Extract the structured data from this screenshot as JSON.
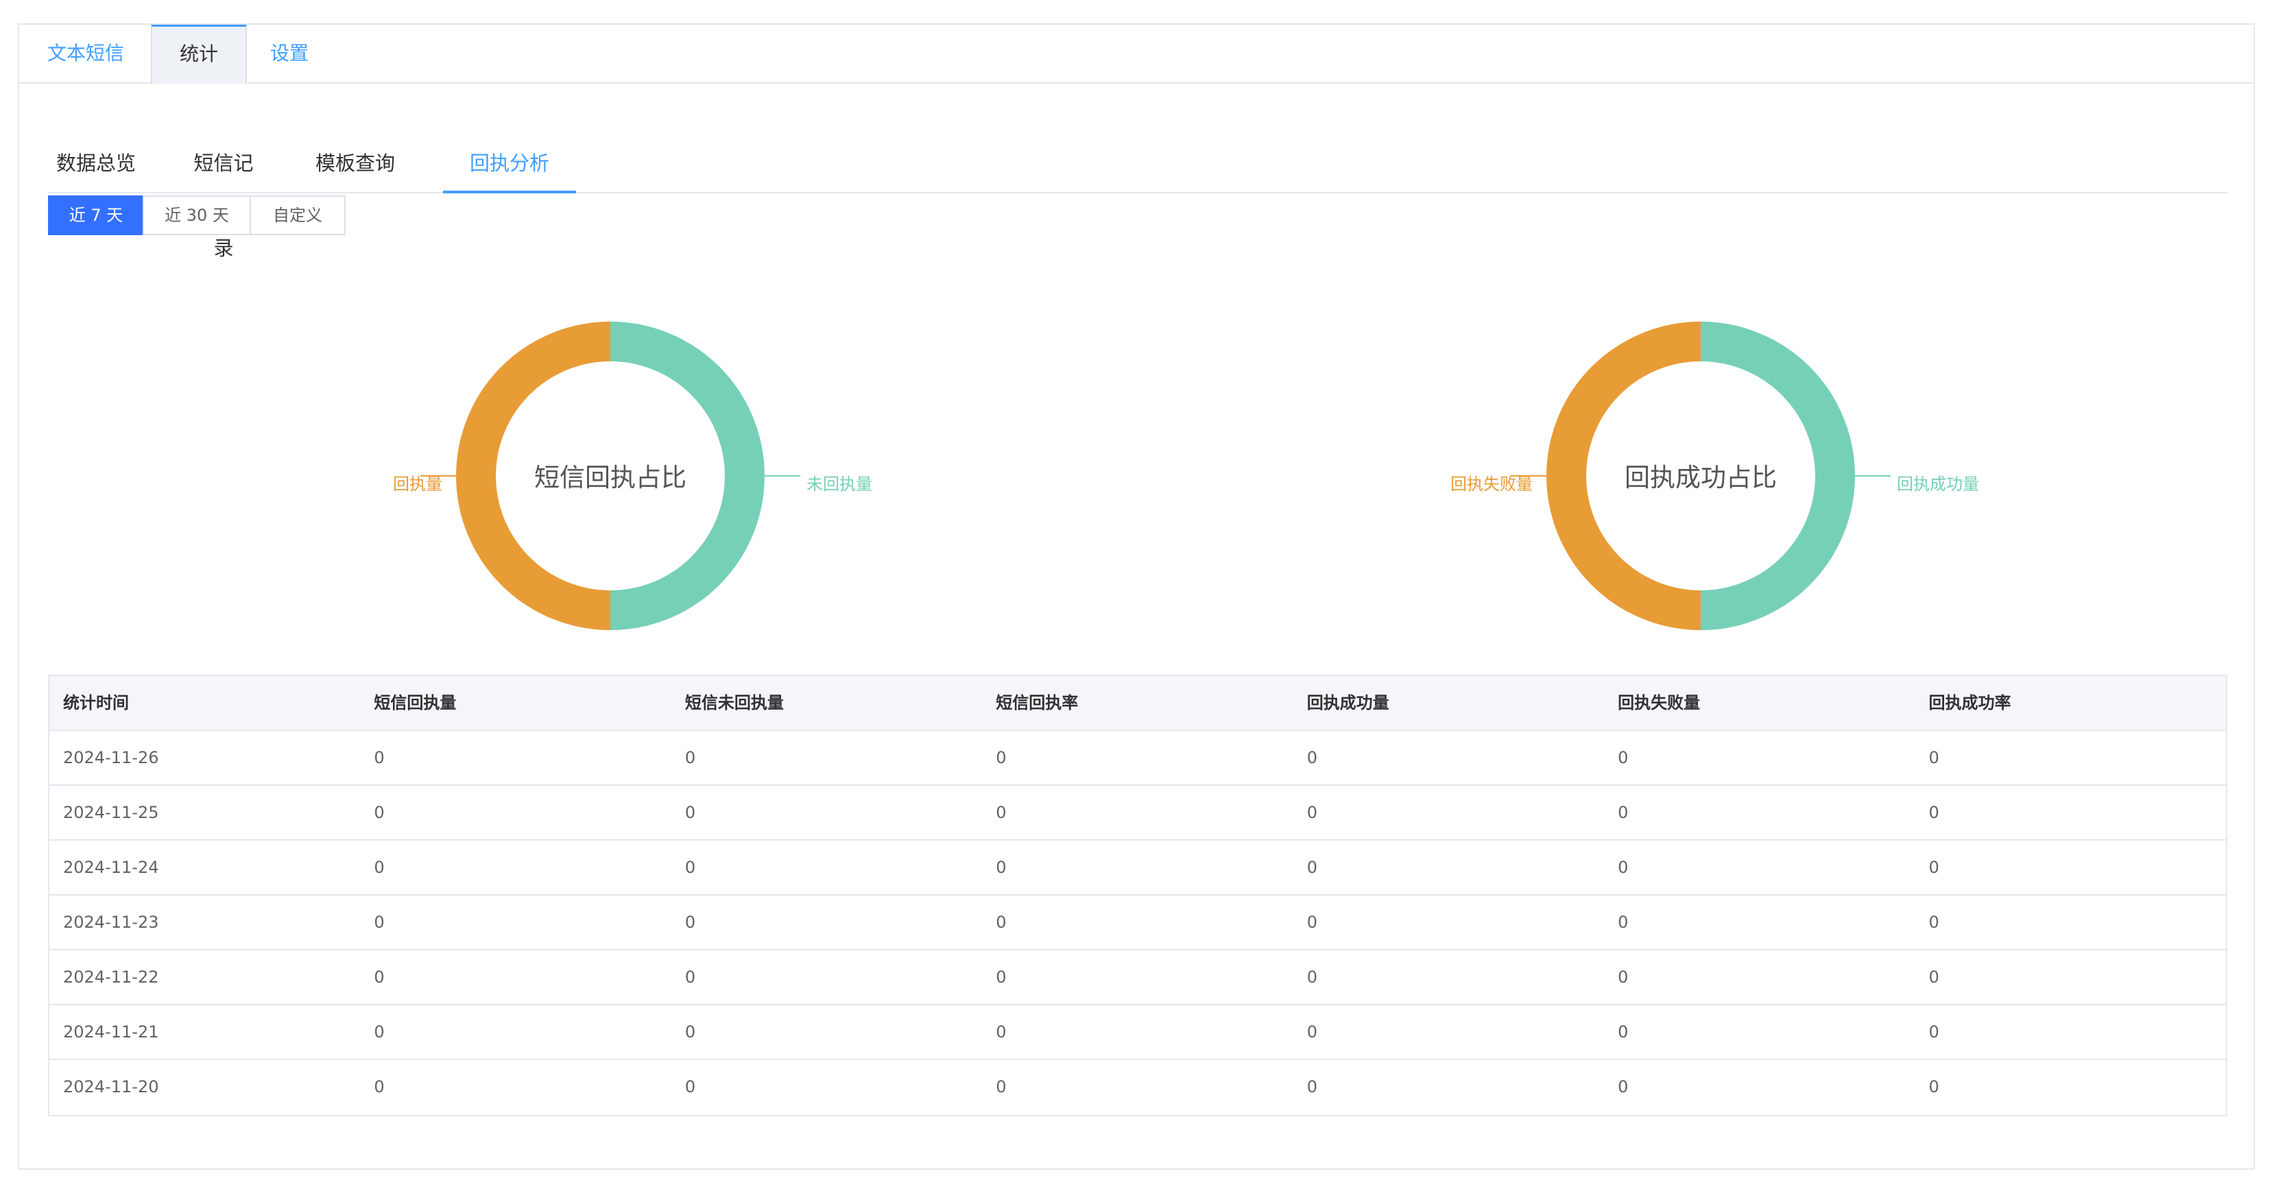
{
  "top_tabs": [
    {
      "label": "文本短信",
      "active": false
    },
    {
      "label": "统计",
      "active": true
    },
    {
      "label": "设置",
      "active": false
    }
  ],
  "sub_tabs": [
    {
      "label": "数据总览",
      "active": false
    },
    {
      "label": "短信记录",
      "active": false
    },
    {
      "label": "模板查询",
      "active": false
    },
    {
      "label": "回执分析",
      "active": true
    }
  ],
  "range_buttons": [
    {
      "label": "近 7 天",
      "active": true
    },
    {
      "label": "近 30 天",
      "active": false
    },
    {
      "label": "自定义",
      "active": false
    }
  ],
  "colors": {
    "accent": "#409eff",
    "primary_btn": "#3370ff",
    "orange": "#e89c36",
    "teal": "#76d0b7"
  },
  "chart_data": [
    {
      "type": "pie",
      "title": "短信回执占比",
      "slices": [
        {
          "name": "回执量",
          "value": 50,
          "color": "#e89c36"
        },
        {
          "name": "未回执量",
          "value": 50,
          "color": "#76d0b7"
        }
      ]
    },
    {
      "type": "pie",
      "title": "回执成功占比",
      "slices": [
        {
          "name": "回执失败量",
          "value": 50,
          "color": "#e89c36"
        },
        {
          "name": "回执成功量",
          "value": 50,
          "color": "#76d0b7"
        }
      ]
    }
  ],
  "table": {
    "headers": [
      "统计时间",
      "短信回执量",
      "短信未回执量",
      "短信回执率",
      "回执成功量",
      "回执失败量",
      "回执成功率"
    ],
    "rows": [
      [
        "2024-11-26",
        "0",
        "0",
        "0",
        "0",
        "0",
        "0"
      ],
      [
        "2024-11-25",
        "0",
        "0",
        "0",
        "0",
        "0",
        "0"
      ],
      [
        "2024-11-24",
        "0",
        "0",
        "0",
        "0",
        "0",
        "0"
      ],
      [
        "2024-11-23",
        "0",
        "0",
        "0",
        "0",
        "0",
        "0"
      ],
      [
        "2024-11-22",
        "0",
        "0",
        "0",
        "0",
        "0",
        "0"
      ],
      [
        "2024-11-21",
        "0",
        "0",
        "0",
        "0",
        "0",
        "0"
      ],
      [
        "2024-11-20",
        "0",
        "0",
        "0",
        "0",
        "0",
        "0"
      ]
    ]
  }
}
